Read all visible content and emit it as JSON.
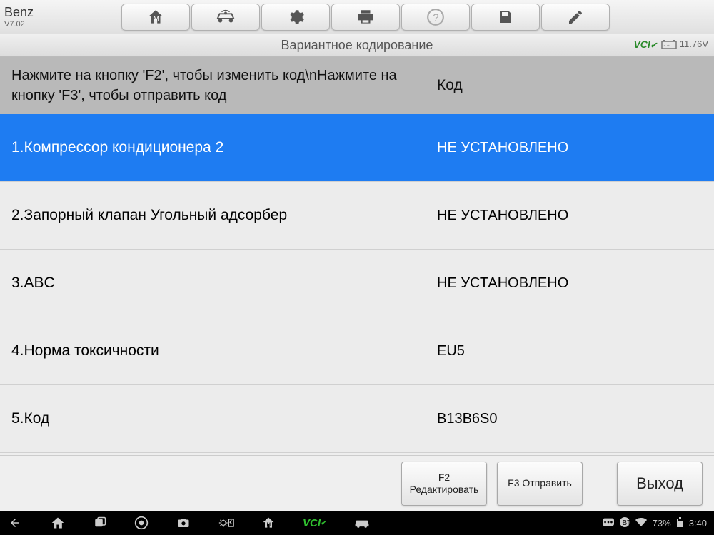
{
  "app": {
    "title": "Benz",
    "version": "V7.02"
  },
  "subheader": {
    "title": "Вариантное кодирование",
    "vci": "VCI",
    "voltage": "11.76V"
  },
  "table": {
    "header": {
      "c1": "Нажмите на кнопку 'F2', чтобы изменить код\\nНажмите на кнопку 'F3', чтобы отправить код",
      "c2": "Код"
    },
    "rows": [
      {
        "c1": "1.Компрессор кондиционера 2",
        "c2": "НЕ УСТАНОВЛЕНО",
        "selected": true
      },
      {
        "c1": "2.Запорный клапан Угольный адсорбер",
        "c2": "НЕ УСТАНОВЛЕНО",
        "selected": false
      },
      {
        "c1": "3.ABC",
        "c2": "НЕ УСТАНОВЛЕНО",
        "selected": false
      },
      {
        "c1": "4.Норма токсичности",
        "c2": "EU5",
        "selected": false
      },
      {
        "c1": "5.Код",
        "c2": "B13B6S0",
        "selected": false
      }
    ]
  },
  "actions": {
    "edit": "F2 Редактировать",
    "send": "F3 Отправить",
    "exit": "Выход"
  },
  "android": {
    "battery": "73%",
    "time": "3:40"
  }
}
